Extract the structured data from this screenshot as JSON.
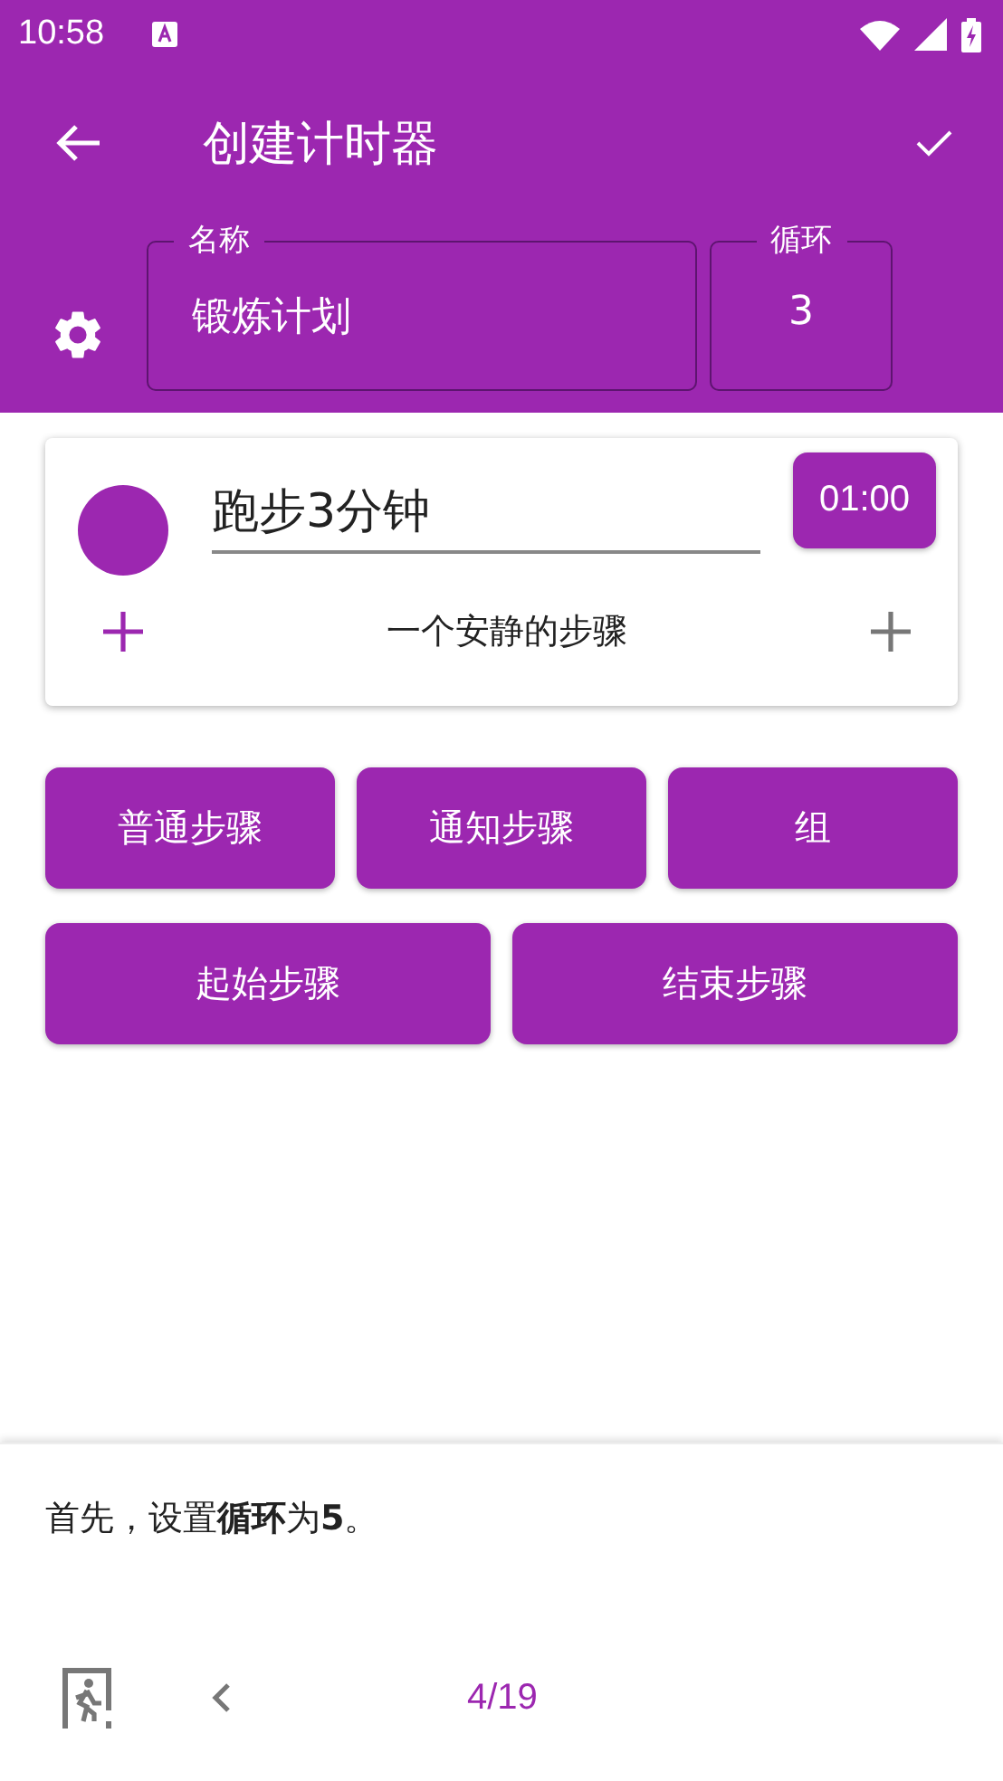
{
  "status_bar": {
    "time": "10:58"
  },
  "toolbar": {
    "title": "创建计时器"
  },
  "name_field": {
    "label": "名称",
    "value": "锻炼计划"
  },
  "loop_field": {
    "label": "循环",
    "value": "3"
  },
  "steps": [
    {
      "name": "跑步3分钟",
      "duration": "01:00",
      "color": "#9c27b0",
      "next_label": "一个安静的步骤"
    }
  ],
  "button_rows": [
    [
      {
        "label": "普通步骤"
      },
      {
        "label": "通知步骤"
      },
      {
        "label": "组"
      }
    ],
    [
      {
        "label": "起始步骤"
      },
      {
        "label": "结束步骤"
      }
    ]
  ],
  "tutorial": {
    "text": "首先，设置**循环**为**5**。",
    "progress": "4/19"
  }
}
